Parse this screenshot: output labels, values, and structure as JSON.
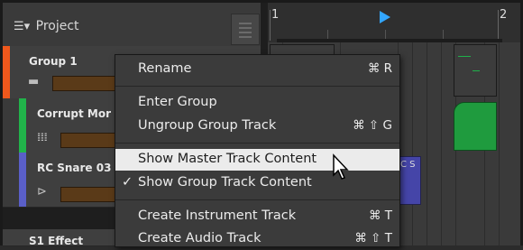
{
  "header": {
    "project_label": "Project"
  },
  "ruler": {
    "bar_1": "1",
    "bar_2": "2"
  },
  "tracks": [
    {
      "name": "Group 1",
      "color": "#f0581c",
      "icon": "folder-icon"
    },
    {
      "name": "Corrupt Mor",
      "color": "#21b34a",
      "icon": "piano-keys-icon"
    },
    {
      "name": "RC Snare 03",
      "color": "#5a5fc8",
      "icon": "audio-waveform-icon"
    },
    {
      "name": "S1 Effect",
      "color": "#5a5fc8"
    }
  ],
  "clip_text": "C S",
  "menu": {
    "items": [
      {
        "label": "Rename",
        "shortcut": "⌘ R"
      },
      {
        "label": "Enter Group",
        "shortcut": ""
      },
      {
        "label": "Ungroup Group Track",
        "shortcut": "⌘ ⇧ G"
      },
      {
        "label": "Show Master Track Content",
        "shortcut": "",
        "highlighted": true
      },
      {
        "label": "Show Group Track Content",
        "shortcut": "",
        "checked": true,
        "check_mark": "✓"
      },
      {
        "label": "Create Instrument Track",
        "shortcut": "⌘ T"
      },
      {
        "label": "Create Audio Track",
        "shortcut": "⌘ ⇧ T"
      }
    ]
  }
}
